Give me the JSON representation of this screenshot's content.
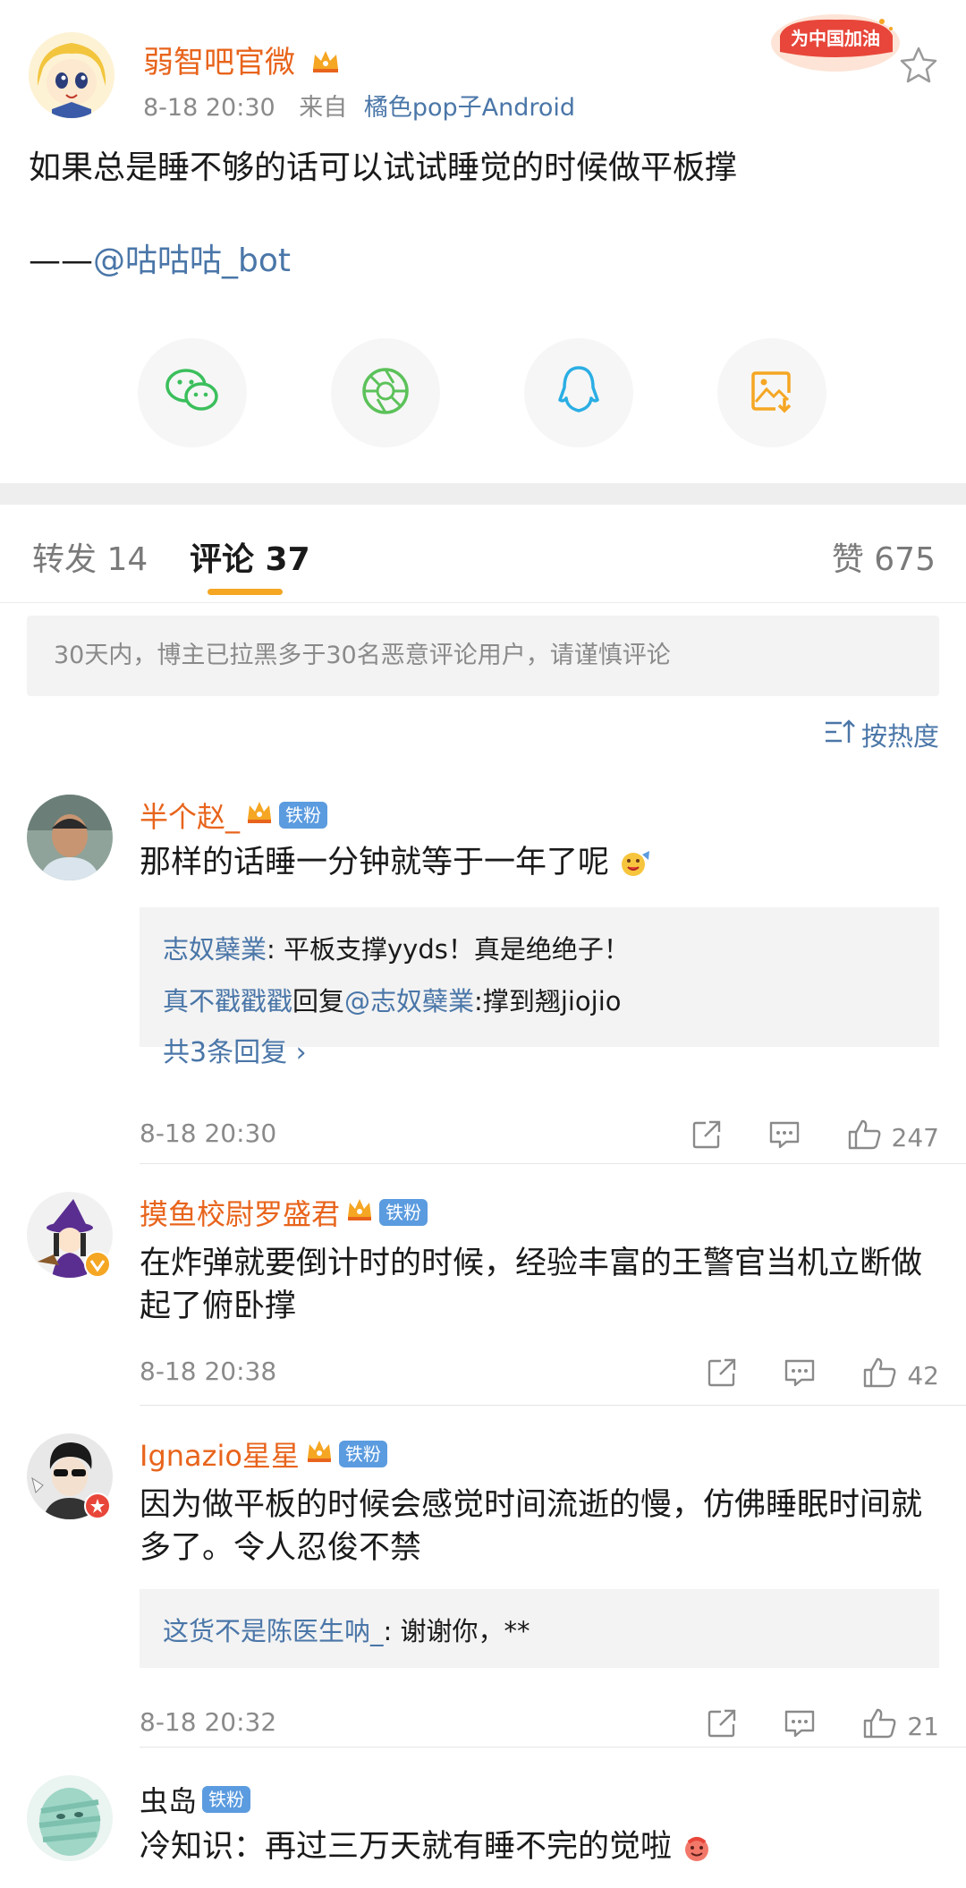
{
  "post": {
    "author": "弱智吧官微",
    "time": "8-18 20:30",
    "from_label": "来自",
    "source": "橘色pop子Android",
    "promo": "为中国加油",
    "text": "如果总是睡不够的话可以试试睡觉的时候做平板撑",
    "credit_prefix": "——",
    "credit_mention": "@咕咕咕_bot",
    "share_icons": [
      "wechat-icon",
      "moments-icon",
      "qq-icon",
      "save-image-icon"
    ]
  },
  "tabs": {
    "repost": "转发 14",
    "comments": "评论 37",
    "likes": "赞 675"
  },
  "notice": "30天内，博主已拉黑多于30名恶意评论用户，请谨慎评论",
  "sort_label": "按热度",
  "comments": [
    {
      "name": "半个赵_",
      "badge": "铁粉",
      "text": "那样的话睡一分钟就等于一年了呢",
      "replies": [
        {
          "user": "志奴蘗業",
          "text": ": 平板支撑yyds！真是绝绝子！"
        },
        {
          "user": "真不戳戳戳",
          "mid": "回复",
          "mention": "@志奴蘗業",
          "text": ":撑到翘jiojio"
        }
      ],
      "more": "共3条回复",
      "time": "8-18 20:30",
      "likes": "247"
    },
    {
      "name": "摸鱼校尉罗盛君",
      "badge": "铁粉",
      "text": "在炸弹就要倒计时的时候，经验丰富的王警官当机立断做起了俯卧撑",
      "time": "8-18 20:38",
      "likes": "42"
    },
    {
      "name": "Ignazio星星",
      "badge": "铁粉",
      "text": "因为做平板的时候会感觉时间流逝的慢，仿佛睡眠时间就多了。令人忍俊不禁",
      "replies": [
        {
          "user": "这货不是陈医生呐_",
          "text": ": 谢谢你，**"
        }
      ],
      "time": "8-18 20:32",
      "likes": "21"
    },
    {
      "name": "虫岛",
      "badge": "铁粉",
      "text": "冷知识：再过三万天就有睡不完的觉啦"
    }
  ],
  "colors": {
    "accent_orange": "#e8641c",
    "link_blue": "#4a76a8",
    "tab_underline": "#f5a623",
    "fan_badge": "#5b9bdf"
  }
}
